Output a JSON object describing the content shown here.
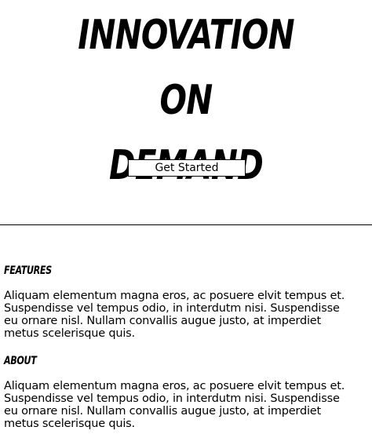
{
  "hero": {
    "title_lines": [
      "Innovation",
      "on",
      "Demand"
    ],
    "cta_label": "Get Started"
  },
  "sections": [
    {
      "heading": "Features",
      "body": "Aliquam elementum magna eros, ac posuere elvit tempus et. Suspendisse vel tempus odio, in interdutm nisi. Suspendisse eu ornare nisl. Nullam convallis augue justo, at imperdiet metus scelerisque quis."
    },
    {
      "heading": "About",
      "body": "Aliquam elementum magna eros, ac posuere elvit tempus et. Suspendisse vel tempus odio, in interdutm nisi. Suspendisse eu ornare nisl. Nullam convallis augue justo, at imperdiet metus scelerisque quis."
    }
  ]
}
